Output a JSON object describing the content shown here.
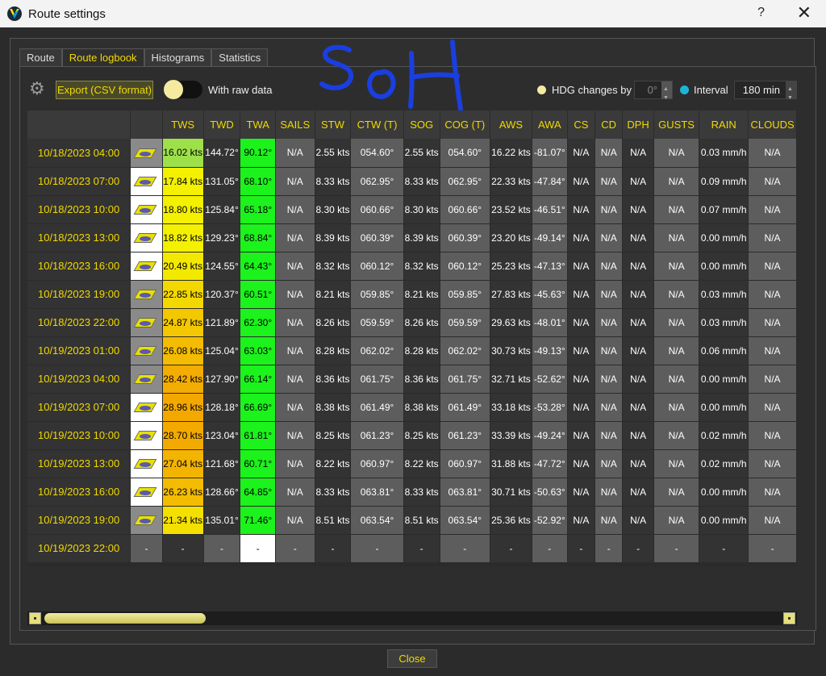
{
  "window": {
    "title": "Route settings",
    "help": "?",
    "close": "✕"
  },
  "tabs": [
    "Route",
    "Route logbook",
    "Histograms",
    "Statistics"
  ],
  "active_tab": 1,
  "toolbar": {
    "export_label": "Export (CSV format)",
    "raw_data_label": "With raw data",
    "raw_data_on": false,
    "hdg_label": "HDG changes by",
    "hdg_value": "0°",
    "interval_label": "Interval",
    "interval_value": "180 min"
  },
  "annotation": {
    "handwritten_text": "SoH",
    "color": "#1a3fe0"
  },
  "columns": [
    "",
    "",
    "TWS",
    "TWD",
    "TWA",
    "SAILS",
    "STW",
    "CTW (T)",
    "SOG",
    "COG (T)",
    "AWS",
    "AWA",
    "CS",
    "CD",
    "DPH",
    "GUSTS",
    "RAIN",
    "CLOUDS"
  ],
  "rows": [
    {
      "date": "10/18/2023 04:00",
      "tws": "16.02 kts",
      "tws_color": "#9ee04a",
      "twd": "144.72°",
      "twa": "90.12°",
      "sails": "N/A",
      "stw": "2.55 kts",
      "ctw": "054.60°",
      "sog": "2.55 kts",
      "cog": "054.60°",
      "aws": "16.22 kts",
      "awa": "-81.07°",
      "cs": "N/A",
      "cd": "N/A",
      "dph": "N/A",
      "gusts": "N/A",
      "rain": "0.03 mm/h",
      "clouds": "N/A",
      "icon_bg": "#8a8a8a"
    },
    {
      "date": "10/18/2023 07:00",
      "tws": "17.84 kts",
      "tws_color": "#f3f000",
      "twd": "131.05°",
      "twa": "68.10°",
      "sails": "N/A",
      "stw": "8.33 kts",
      "ctw": "062.95°",
      "sog": "8.33 kts",
      "cog": "062.95°",
      "aws": "22.33 kts",
      "awa": "-47.84°",
      "cs": "N/A",
      "cd": "N/A",
      "dph": "N/A",
      "gusts": "N/A",
      "rain": "0.09 mm/h",
      "clouds": "N/A",
      "icon_bg": "#ffffff"
    },
    {
      "date": "10/18/2023 10:00",
      "tws": "18.80 kts",
      "tws_color": "#f3f000",
      "twd": "125.84°",
      "twa": "65.18°",
      "sails": "N/A",
      "stw": "8.30 kts",
      "ctw": "060.66°",
      "sog": "8.30 kts",
      "cog": "060.66°",
      "aws": "23.52 kts",
      "awa": "-46.51°",
      "cs": "N/A",
      "cd": "N/A",
      "dph": "N/A",
      "gusts": "N/A",
      "rain": "0.07 mm/h",
      "clouds": "N/A",
      "icon_bg": "#ffffff"
    },
    {
      "date": "10/18/2023 13:00",
      "tws": "18.82 kts",
      "tws_color": "#f3f000",
      "twd": "129.23°",
      "twa": "68.84°",
      "sails": "N/A",
      "stw": "8.39 kts",
      "ctw": "060.39°",
      "sog": "8.39 kts",
      "cog": "060.39°",
      "aws": "23.20 kts",
      "awa": "-49.14°",
      "cs": "N/A",
      "cd": "N/A",
      "dph": "N/A",
      "gusts": "N/A",
      "rain": "0.00 mm/h",
      "clouds": "N/A",
      "icon_bg": "#ffffff"
    },
    {
      "date": "10/18/2023 16:00",
      "tws": "20.49 kts",
      "tws_color": "#f3e800",
      "twd": "124.55°",
      "twa": "64.43°",
      "sails": "N/A",
      "stw": "8.32 kts",
      "ctw": "060.12°",
      "sog": "8.32 kts",
      "cog": "060.12°",
      "aws": "25.23 kts",
      "awa": "-47.13°",
      "cs": "N/A",
      "cd": "N/A",
      "dph": "N/A",
      "gusts": "N/A",
      "rain": "0.00 mm/h",
      "clouds": "N/A",
      "icon_bg": "#ffffff"
    },
    {
      "date": "10/18/2023 19:00",
      "tws": "22.85 kts",
      "tws_color": "#f3d800",
      "twd": "120.37°",
      "twa": "60.51°",
      "sails": "N/A",
      "stw": "8.21 kts",
      "ctw": "059.85°",
      "sog": "8.21 kts",
      "cog": "059.85°",
      "aws": "27.83 kts",
      "awa": "-45.63°",
      "cs": "N/A",
      "cd": "N/A",
      "dph": "N/A",
      "gusts": "N/A",
      "rain": "0.03 mm/h",
      "clouds": "N/A",
      "icon_bg": "#8a8a8a"
    },
    {
      "date": "10/18/2023 22:00",
      "tws": "24.87 kts",
      "tws_color": "#f3c800",
      "twd": "121.89°",
      "twa": "62.30°",
      "sails": "N/A",
      "stw": "8.26 kts",
      "ctw": "059.59°",
      "sog": "8.26 kts",
      "cog": "059.59°",
      "aws": "29.63 kts",
      "awa": "-48.01°",
      "cs": "N/A",
      "cd": "N/A",
      "dph": "N/A",
      "gusts": "N/A",
      "rain": "0.03 mm/h",
      "clouds": "N/A",
      "icon_bg": "#8a8a8a"
    },
    {
      "date": "10/19/2023 01:00",
      "tws": "26.08 kts",
      "tws_color": "#f3bc00",
      "twd": "125.04°",
      "twa": "63.03°",
      "sails": "N/A",
      "stw": "8.28 kts",
      "ctw": "062.02°",
      "sog": "8.28 kts",
      "cog": "062.02°",
      "aws": "30.73 kts",
      "awa": "-49.13°",
      "cs": "N/A",
      "cd": "N/A",
      "dph": "N/A",
      "gusts": "N/A",
      "rain": "0.06 mm/h",
      "clouds": "N/A",
      "icon_bg": "#8a8a8a"
    },
    {
      "date": "10/19/2023 04:00",
      "tws": "28.42 kts",
      "tws_color": "#f3ac00",
      "twd": "127.90°",
      "twa": "66.14°",
      "sails": "N/A",
      "stw": "8.36 kts",
      "ctw": "061.75°",
      "sog": "8.36 kts",
      "cog": "061.75°",
      "aws": "32.71 kts",
      "awa": "-52.62°",
      "cs": "N/A",
      "cd": "N/A",
      "dph": "N/A",
      "gusts": "N/A",
      "rain": "0.00 mm/h",
      "clouds": "N/A",
      "icon_bg": "#8a8a8a"
    },
    {
      "date": "10/19/2023 07:00",
      "tws": "28.96 kts",
      "tws_color": "#f3a800",
      "twd": "128.18°",
      "twa": "66.69°",
      "sails": "N/A",
      "stw": "8.38 kts",
      "ctw": "061.49°",
      "sog": "8.38 kts",
      "cog": "061.49°",
      "aws": "33.18 kts",
      "awa": "-53.28°",
      "cs": "N/A",
      "cd": "N/A",
      "dph": "N/A",
      "gusts": "N/A",
      "rain": "0.00 mm/h",
      "clouds": "N/A",
      "icon_bg": "#ffffff"
    },
    {
      "date": "10/19/2023 10:00",
      "tws": "28.70 kts",
      "tws_color": "#f3aa00",
      "twd": "123.04°",
      "twa": "61.81°",
      "sails": "N/A",
      "stw": "8.25 kts",
      "ctw": "061.23°",
      "sog": "8.25 kts",
      "cog": "061.23°",
      "aws": "33.39 kts",
      "awa": "-49.24°",
      "cs": "N/A",
      "cd": "N/A",
      "dph": "N/A",
      "gusts": "N/A",
      "rain": "0.02 mm/h",
      "clouds": "N/A",
      "icon_bg": "#ffffff"
    },
    {
      "date": "10/19/2023 13:00",
      "tws": "27.04 kts",
      "tws_color": "#f3b400",
      "twd": "121.68°",
      "twa": "60.71°",
      "sails": "N/A",
      "stw": "8.22 kts",
      "ctw": "060.97°",
      "sog": "8.22 kts",
      "cog": "060.97°",
      "aws": "31.88 kts",
      "awa": "-47.72°",
      "cs": "N/A",
      "cd": "N/A",
      "dph": "N/A",
      "gusts": "N/A",
      "rain": "0.02 mm/h",
      "clouds": "N/A",
      "icon_bg": "#ffffff"
    },
    {
      "date": "10/19/2023 16:00",
      "tws": "26.23 kts",
      "tws_color": "#f3bc00",
      "twd": "128.66°",
      "twa": "64.85°",
      "sails": "N/A",
      "stw": "8.33 kts",
      "ctw": "063.81°",
      "sog": "8.33 kts",
      "cog": "063.81°",
      "aws": "30.71 kts",
      "awa": "-50.63°",
      "cs": "N/A",
      "cd": "N/A",
      "dph": "N/A",
      "gusts": "N/A",
      "rain": "0.00 mm/h",
      "clouds": "N/A",
      "icon_bg": "#ffffff"
    },
    {
      "date": "10/19/2023 19:00",
      "tws": "21.34 kts",
      "tws_color": "#f3e000",
      "twd": "135.01°",
      "twa": "71.46°",
      "sails": "N/A",
      "stw": "8.51 kts",
      "ctw": "063.54°",
      "sog": "8.51 kts",
      "cog": "063.54°",
      "aws": "25.36 kts",
      "awa": "-52.92°",
      "cs": "N/A",
      "cd": "N/A",
      "dph": "N/A",
      "gusts": "N/A",
      "rain": "0.00 mm/h",
      "clouds": "N/A",
      "icon_bg": "#8a8a8a"
    },
    {
      "date": "10/19/2023 22:00",
      "tws": "-",
      "tws_color": "#333333",
      "twd": "-",
      "twa": "-",
      "sails": "-",
      "stw": "-",
      "ctw": "-",
      "sog": "-",
      "cog": "-",
      "aws": "-",
      "awa": "-",
      "cs": "-",
      "cd": "-",
      "dph": "-",
      "gusts": "-",
      "rain": "-",
      "clouds": "-",
      "icon_bg": "#5d5d5d",
      "last": true
    }
  ],
  "scrollbar": {
    "position_fraction": 0.0
  },
  "close_label": "Close",
  "colors": {
    "accent": "#f0d900",
    "twa_green": "#1cf21c"
  }
}
